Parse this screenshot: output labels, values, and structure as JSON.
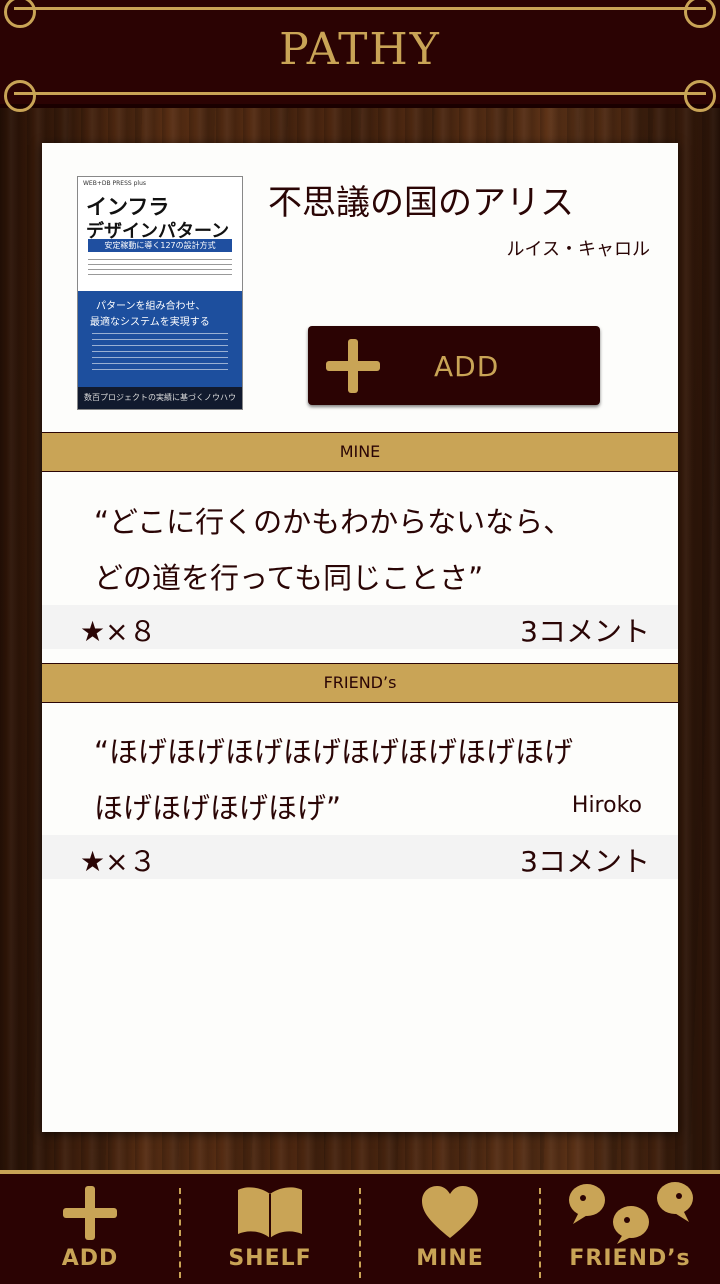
{
  "app": {
    "title": "PATHY"
  },
  "book": {
    "title": "不思議の国のアリス",
    "author": "ルイス・キャロル",
    "cover": {
      "series": "WEB+DB PRESS plus",
      "title_line1": "インフラ",
      "title_line2": "デザインパターン",
      "subtitle": "安定稼動に導く127の設計方式",
      "tagline1": "パターンを組み合わせ、",
      "tagline2": "最適なシステムを実現する",
      "footer": "数百プロジェクトの実績に基づくノウハウ"
    },
    "add_label": "ADD"
  },
  "sections": {
    "mine": {
      "header": "MINE",
      "quote_line1": "“どこに行くのかもわからないなら、",
      "quote_line2": "どの道を行っても同じことさ”",
      "stars": "★×８",
      "comments": "3コメント"
    },
    "friends": {
      "header": "FRIEND’s",
      "quote_line1": "“ほげほげほげほげほげほげほげほげ",
      "quote_line2": "ほげほげほげほげ”",
      "friend_name": "Hiroko",
      "stars": "★×３",
      "comments": "3コメント"
    }
  },
  "nav": {
    "add": "ADD",
    "shelf": "SHELF",
    "mine": "MINE",
    "friends": "FRIEND’s"
  },
  "colors": {
    "accent": "#c9a456",
    "dark": "#2b0303"
  }
}
